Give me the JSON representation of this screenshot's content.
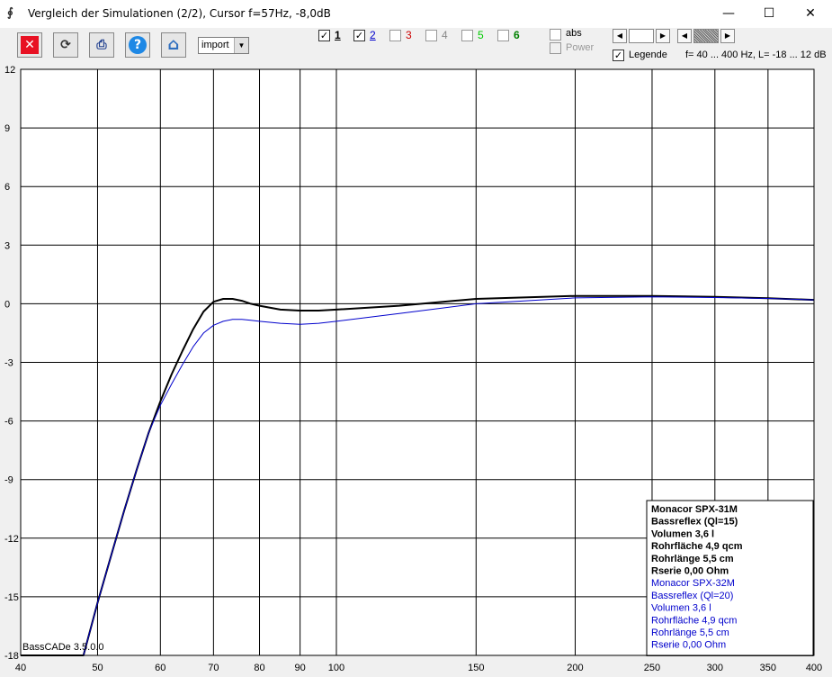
{
  "window": {
    "title": "Vergleich der Simulationen (2/2), Cursor f=57Hz, -8,0dB",
    "app_icon_glyph": "∮",
    "minimize": "—",
    "maximize": "☐",
    "close": "✕"
  },
  "toolbar": {
    "buttons": [
      {
        "name": "close-icon",
        "glyph": "✕",
        "color": "#e81123"
      },
      {
        "name": "refresh-icon",
        "glyph": "⟳",
        "color": "#333333"
      },
      {
        "name": "print-icon",
        "glyph": "⎙",
        "color": "#1f3f8f"
      },
      {
        "name": "help-icon",
        "glyph": "?",
        "color": "#1e88e5"
      },
      {
        "name": "home-icon",
        "glyph": "⌂",
        "color": "#2f6fbf"
      }
    ],
    "import_value": "import",
    "series_checks": [
      {
        "label": "1",
        "checked": true,
        "color": "#000000",
        "bold": true,
        "underline": true
      },
      {
        "label": "2",
        "checked": true,
        "color": "#0000cc",
        "bold": false,
        "underline": true
      },
      {
        "label": "3",
        "checked": false,
        "color": "#cc0000",
        "bold": false,
        "underline": false
      },
      {
        "label": "4",
        "checked": false,
        "color": "#888888",
        "bold": false,
        "underline": false
      },
      {
        "label": "5",
        "checked": false,
        "color": "#00cc00",
        "bold": false,
        "underline": false
      },
      {
        "label": "6",
        "checked": false,
        "color": "#008000",
        "bold": true,
        "underline": false
      }
    ],
    "abs_label": "abs",
    "power_label": "Power",
    "legende_label": "Legende",
    "legende_checked": true,
    "range_text": "f= 40 ... 400 Hz, L= -18 ... 12 dB"
  },
  "chart_data": {
    "type": "line",
    "x_scale": "log",
    "xlim": [
      40,
      400
    ],
    "ylim": [
      -18,
      12
    ],
    "x_ticks": [
      40,
      50,
      60,
      70,
      80,
      90,
      100,
      150,
      200,
      250,
      300,
      350,
      400
    ],
    "y_ticks": [
      12,
      9,
      6,
      3,
      0,
      -3,
      -6,
      -9,
      -12,
      -15,
      -18
    ],
    "grid": true,
    "series": [
      {
        "color": "#000000",
        "width": 2,
        "x": [
          40,
          48,
          50,
          52,
          54,
          56,
          58,
          60,
          62,
          64,
          66,
          68,
          70,
          72,
          74,
          76,
          78,
          80,
          85,
          90,
          95,
          100,
          120,
          150,
          200,
          250,
          300,
          350,
          400
        ],
        "y": [
          -18,
          -18,
          -15.3,
          -12.9,
          -10.6,
          -8.5,
          -6.6,
          -5.0,
          -3.6,
          -2.4,
          -1.3,
          -0.4,
          0.1,
          0.25,
          0.25,
          0.15,
          0.0,
          -0.1,
          -0.3,
          -0.35,
          -0.35,
          -0.3,
          -0.1,
          0.25,
          0.4,
          0.4,
          0.35,
          0.28,
          0.2
        ]
      },
      {
        "color": "#0000cc",
        "width": 1,
        "x": [
          40,
          48,
          50,
          52,
          54,
          56,
          58,
          60,
          62,
          64,
          66,
          68,
          70,
          72,
          74,
          76,
          78,
          80,
          85,
          90,
          95,
          100,
          120,
          150,
          200,
          250,
          300,
          350,
          400
        ],
        "y": [
          -18,
          -18,
          -15.3,
          -12.9,
          -10.6,
          -8.5,
          -6.6,
          -5.2,
          -4.1,
          -3.1,
          -2.2,
          -1.5,
          -1.1,
          -0.9,
          -0.8,
          -0.8,
          -0.85,
          -0.9,
          -1.0,
          -1.05,
          -1.0,
          -0.9,
          -0.5,
          0.0,
          0.3,
          0.35,
          0.32,
          0.27,
          0.2
        ]
      }
    ],
    "legend": {
      "position": "bottom-right",
      "blocks": [
        {
          "color": "#000000",
          "bold": true,
          "lines": [
            "Monacor SPX-31M",
            "Bassreflex (Ql=15)",
            "Volumen 3,6 l",
            "Rohrfläche 4,9 qcm",
            "Rohrlänge 5,5 cm",
            "Rserie 0,00 Ohm"
          ]
        },
        {
          "color": "#0000cc",
          "bold": false,
          "lines": [
            "Monacor SPX-32M",
            "Bassreflex (Ql=20)",
            "Volumen 3,6 l",
            "Rohrfläche 4,9 qcm",
            "Rohrlänge 5,5 cm",
            "Rserie 0,00 Ohm"
          ]
        }
      ]
    },
    "watermark": "BassCADe 3.5.0.0"
  }
}
